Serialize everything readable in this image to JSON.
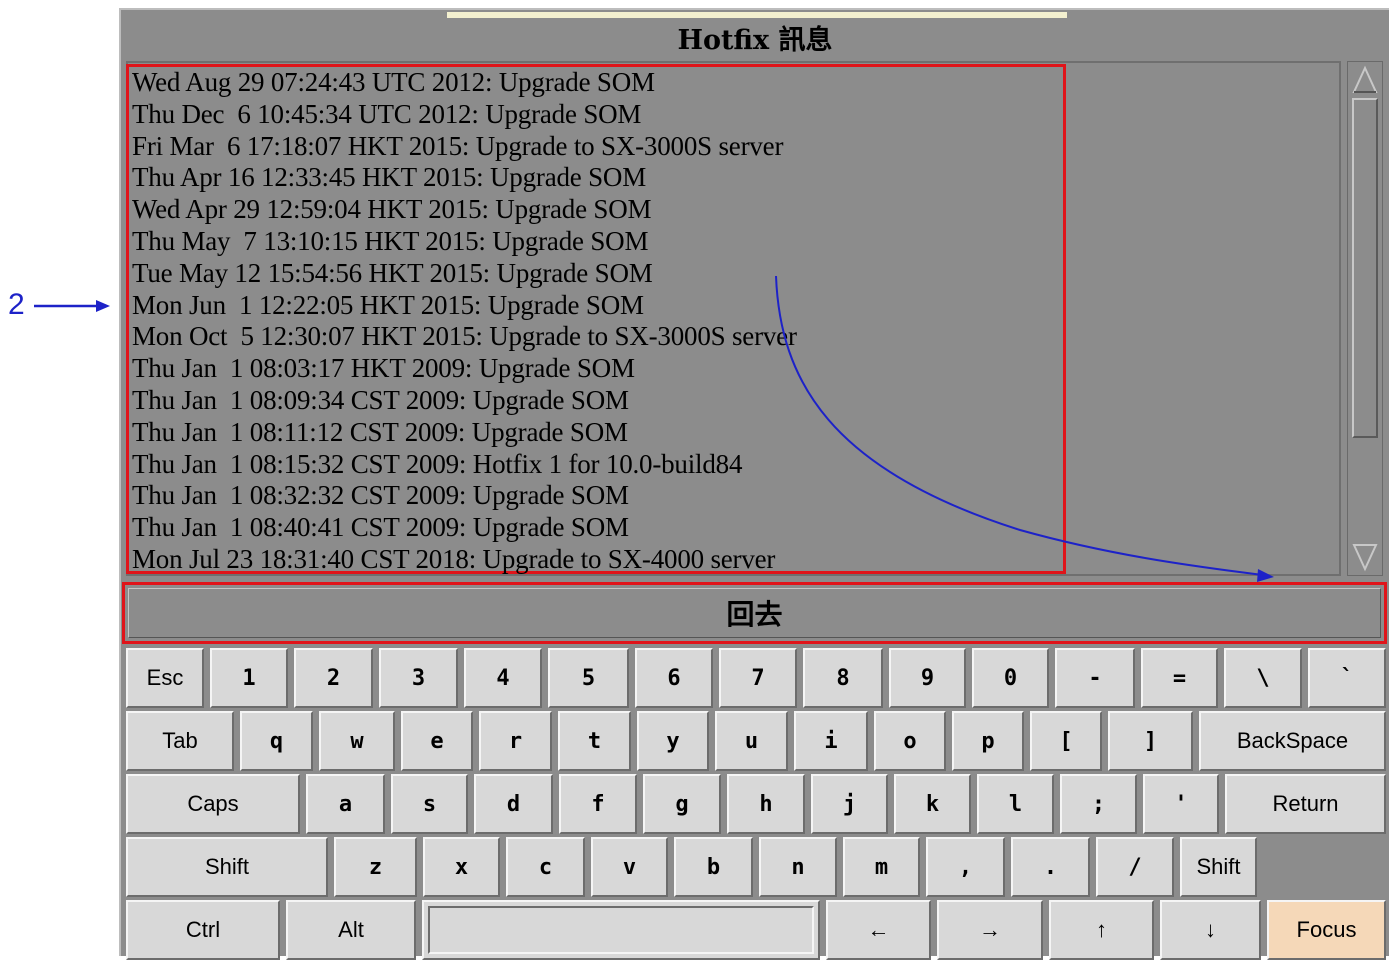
{
  "annotation": {
    "label": "2"
  },
  "window": {
    "title": "Hotfix 訊息"
  },
  "log": {
    "lines": [
      "Wed Aug 29 07:24:43 UTC 2012: Upgrade SOM",
      "Thu Dec  6 10:45:34 UTC 2012: Upgrade SOM",
      "Fri Mar  6 17:18:07 HKT 2015: Upgrade to SX-3000S server",
      "Thu Apr 16 12:33:45 HKT 2015: Upgrade SOM",
      "Wed Apr 29 12:59:04 HKT 2015: Upgrade SOM",
      "Thu May  7 13:10:15 HKT 2015: Upgrade SOM",
      "Tue May 12 15:54:56 HKT 2015: Upgrade SOM",
      "Mon Jun  1 12:22:05 HKT 2015: Upgrade SOM",
      "Mon Oct  5 12:30:07 HKT 2015: Upgrade to SX-3000S server",
      "Thu Jan  1 08:03:17 HKT 2009: Upgrade SOM",
      "Thu Jan  1 08:09:34 CST 2009: Upgrade SOM",
      "Thu Jan  1 08:11:12 CST 2009: Upgrade SOM",
      "Thu Jan  1 08:15:32 CST 2009: Hotfix 1 for 10.0-build84",
      "Thu Jan  1 08:32:32 CST 2009: Upgrade SOM",
      "Thu Jan  1 08:40:41 CST 2009: Upgrade SOM",
      "Mon Jul 23 18:31:40 CST 2018: Upgrade to SX-4000 server"
    ]
  },
  "back_button": {
    "label": "回去"
  },
  "keyboard": {
    "row1": [
      "Esc",
      "1",
      "2",
      "3",
      "4",
      "5",
      "6",
      "7",
      "8",
      "9",
      "0",
      "-",
      "=",
      "\\",
      "`"
    ],
    "row2": [
      "Tab",
      "q",
      "w",
      "e",
      "r",
      "t",
      "y",
      "u",
      "i",
      "o",
      "p",
      "[",
      "]",
      "BackSpace"
    ],
    "row3": [
      "Caps",
      "a",
      "s",
      "d",
      "f",
      "g",
      "h",
      "j",
      "k",
      "l",
      ";",
      "'",
      "Return"
    ],
    "row4": [
      "Shift",
      "z",
      "x",
      "c",
      "v",
      "b",
      "n",
      "m",
      ",",
      ".",
      "/",
      "Shift"
    ],
    "row5": [
      "Ctrl",
      "Alt",
      "",
      "←",
      "→",
      "↑",
      "↓",
      "Focus"
    ]
  },
  "colors": {
    "highlight": "#e0141a",
    "annotation": "#1d22c8",
    "panel": "#8c8c8c",
    "focus_key": "#f5d8b8"
  }
}
